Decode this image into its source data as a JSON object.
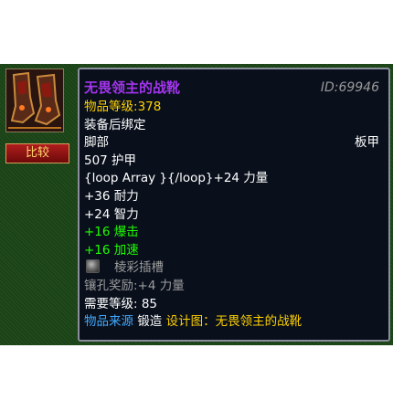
{
  "compare_button": {
    "label": "比较"
  },
  "tooltip": {
    "name": "无畏领主的战靴",
    "item_id": "ID:69946",
    "item_level_label": "物品等级:",
    "item_level_value": "378",
    "bind": "装备后绑定",
    "slot": "脚部",
    "armor_type": "板甲",
    "armor": "507 护甲",
    "stat_line": "{loop Array }{/loop}+24 力量",
    "stamina": "+36 耐力",
    "intellect": "+24 智力",
    "crit": "+16 爆击",
    "haste": "+16 加速",
    "socket_label": "棱彩插槽",
    "socket_bonus": "镶孔奖励:+4 力量",
    "required_level": "需要等级: 85",
    "source_label": "物品来源",
    "source_type": "锻造",
    "source_detail": "设计图：无畏领主的战靴"
  },
  "colors": {
    "epic": "#a335ee",
    "yellow": "#ffd100",
    "green": "#1eff00",
    "gray": "#9d9d9d",
    "blue": "#40a8ff"
  },
  "icons": {
    "item": "plate-boots-icon",
    "socket": "prismatic-socket-icon"
  }
}
